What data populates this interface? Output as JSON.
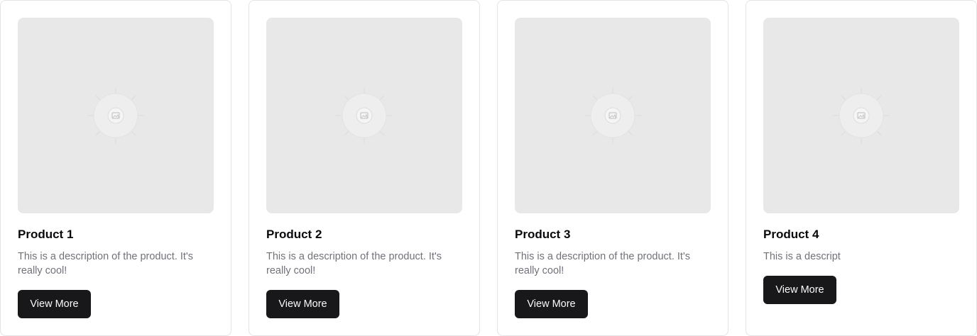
{
  "products": [
    {
      "title": "Product 1",
      "description": "This is a description of the product. It's really cool!",
      "button_label": "View More",
      "image_icon": "image-placeholder-icon"
    },
    {
      "title": "Product 2",
      "description": "This is a description of the product. It's really cool!",
      "button_label": "View More",
      "image_icon": "image-placeholder-icon"
    },
    {
      "title": "Product 3",
      "description": "This is a description of the product. It's really cool!",
      "button_label": "View More",
      "image_icon": "image-placeholder-icon"
    },
    {
      "title": "Product 4",
      "description": "This is a descript",
      "button_label": "View More",
      "image_icon": "image-placeholder-icon"
    }
  ],
  "colors": {
    "button_bg": "#18181b",
    "button_text": "#fafafa",
    "title": "#09090b",
    "description": "#71717a",
    "placeholder_bg": "#e8e8e8",
    "card_border": "#e4e4e7"
  }
}
